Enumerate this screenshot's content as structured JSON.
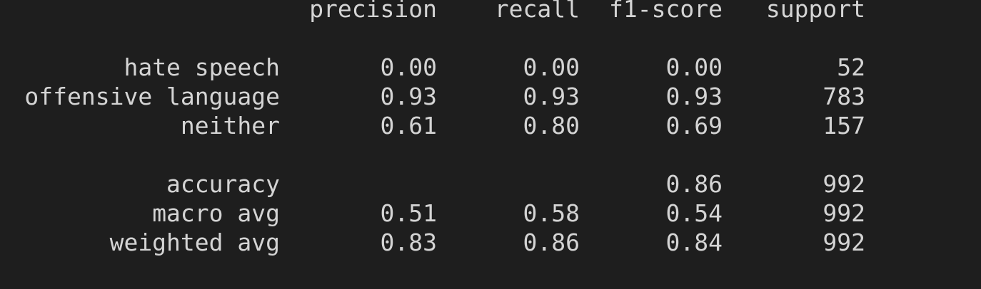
{
  "colors": {
    "background": "#1e1e1e",
    "text": "#d4d4d4"
  },
  "report": {
    "headers": {
      "precision": "precision",
      "recall": "recall",
      "f1_score": "f1-score",
      "support": "support"
    },
    "class_rows": [
      {
        "label": "hate speech",
        "precision": "0.00",
        "recall": "0.00",
        "f1_score": "0.00",
        "support": "52"
      },
      {
        "label": "offensive language",
        "precision": "0.93",
        "recall": "0.93",
        "f1_score": "0.93",
        "support": "783"
      },
      {
        "label": "neither",
        "precision": "0.61",
        "recall": "0.80",
        "f1_score": "0.69",
        "support": "157"
      }
    ],
    "summary_rows": [
      {
        "label": "accuracy",
        "precision": "",
        "recall": "",
        "f1_score": "0.86",
        "support": "992"
      },
      {
        "label": "macro avg",
        "precision": "0.51",
        "recall": "0.58",
        "f1_score": "0.54",
        "support": "992"
      },
      {
        "label": "weighted avg",
        "precision": "0.83",
        "recall": "0.86",
        "f1_score": "0.84",
        "support": "992"
      }
    ]
  }
}
